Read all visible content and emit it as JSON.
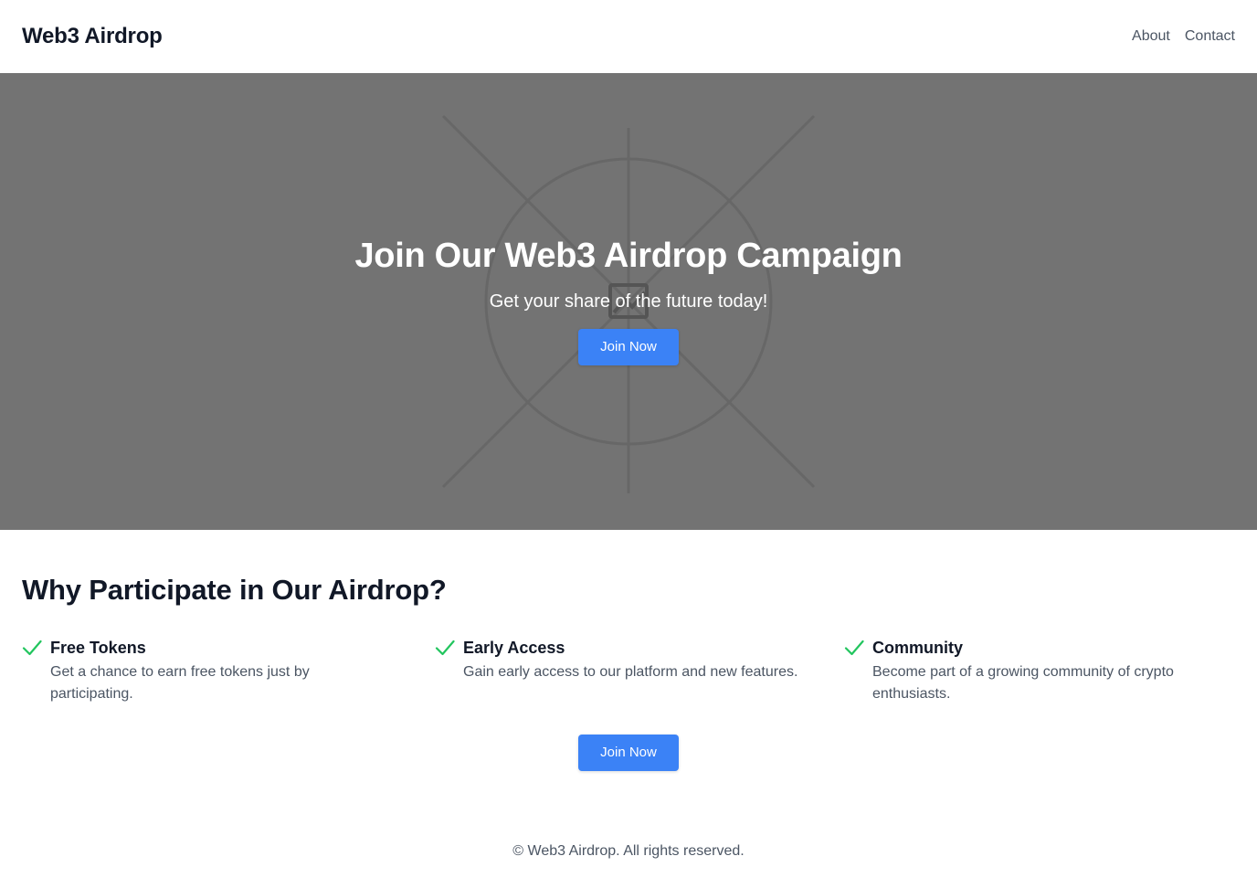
{
  "header": {
    "brand": "Web3 Airdrop",
    "nav": [
      {
        "label": "About"
      },
      {
        "label": "Contact"
      }
    ]
  },
  "hero": {
    "title": "Join Our Web3 Airdrop Campaign",
    "subtitle": "Get your share of the future today!",
    "cta_label": "Join Now"
  },
  "features_section": {
    "title": "Why Participate in Our Airdrop?",
    "items": [
      {
        "icon": "check-icon",
        "title": "Free Tokens",
        "description": "Get a chance to earn free tokens just by participating."
      },
      {
        "icon": "check-icon",
        "title": "Early Access",
        "description": "Gain early access to our platform and new features."
      },
      {
        "icon": "check-icon",
        "title": "Community",
        "description": "Become part of a growing community of crypto enthusiasts."
      }
    ],
    "cta_label": "Join Now"
  },
  "footer": {
    "text": "© Web3 Airdrop. All rights reserved."
  },
  "colors": {
    "accent": "#3b82f6",
    "check": "#22c55e",
    "hero_background": "#737373",
    "heading": "#111827",
    "body_text": "#4b5563"
  }
}
